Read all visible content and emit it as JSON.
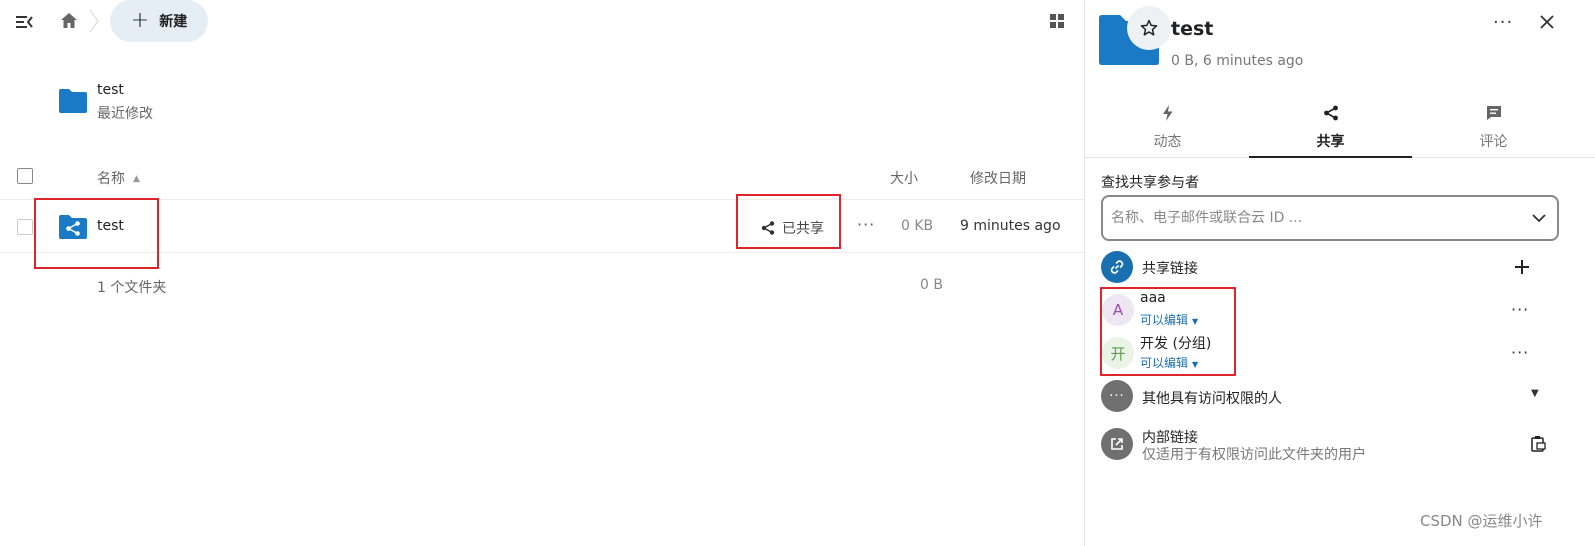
{
  "topbar": {
    "nav_toggle_icon": "menu-collapse-icon",
    "home_icon": "home-icon",
    "new_button_label": "新建",
    "grid_icon": "grid-view-icon"
  },
  "recent": {
    "name": "test",
    "subtitle": "最近修改"
  },
  "table": {
    "headers": {
      "name": "名称",
      "size": "大小",
      "modified": "修改日期"
    },
    "rows": [
      {
        "name": "test",
        "share_label": "已共享",
        "size": "0 KB",
        "modified": "9 minutes ago"
      }
    ],
    "summary": {
      "count": "1 个文件夹",
      "total": "0 B"
    }
  },
  "sidebar": {
    "title": "test",
    "subtitle": "0 B, 6 minutes ago",
    "tabs": [
      {
        "label": "动态",
        "icon": "activity-icon"
      },
      {
        "label": "共享",
        "icon": "share-icon",
        "active": true
      },
      {
        "label": "评论",
        "icon": "comment-icon"
      }
    ],
    "search": {
      "label": "查找共享参与者",
      "placeholder": "名称、电子邮件或联合云 ID ..."
    },
    "share_link": {
      "label": "共享链接"
    },
    "shares": [
      {
        "avatar": "A",
        "name": "aaa",
        "permission": "可以编辑"
      },
      {
        "avatar": "开",
        "name": "开发 (分组)",
        "permission": "可以编辑"
      }
    ],
    "others": {
      "label": "其他具有访问权限的人"
    },
    "internal_link": {
      "label": "内部链接",
      "subtitle": "仅适用于有权限访问此文件夹的用户"
    }
  },
  "watermark": "CSDN @运维小许",
  "colors": {
    "folder_blue": "#1a7ac6",
    "accent_link": "#1a6fb0",
    "highlight_red": "#e0242b",
    "new_button_bg": "#e6eef5"
  }
}
